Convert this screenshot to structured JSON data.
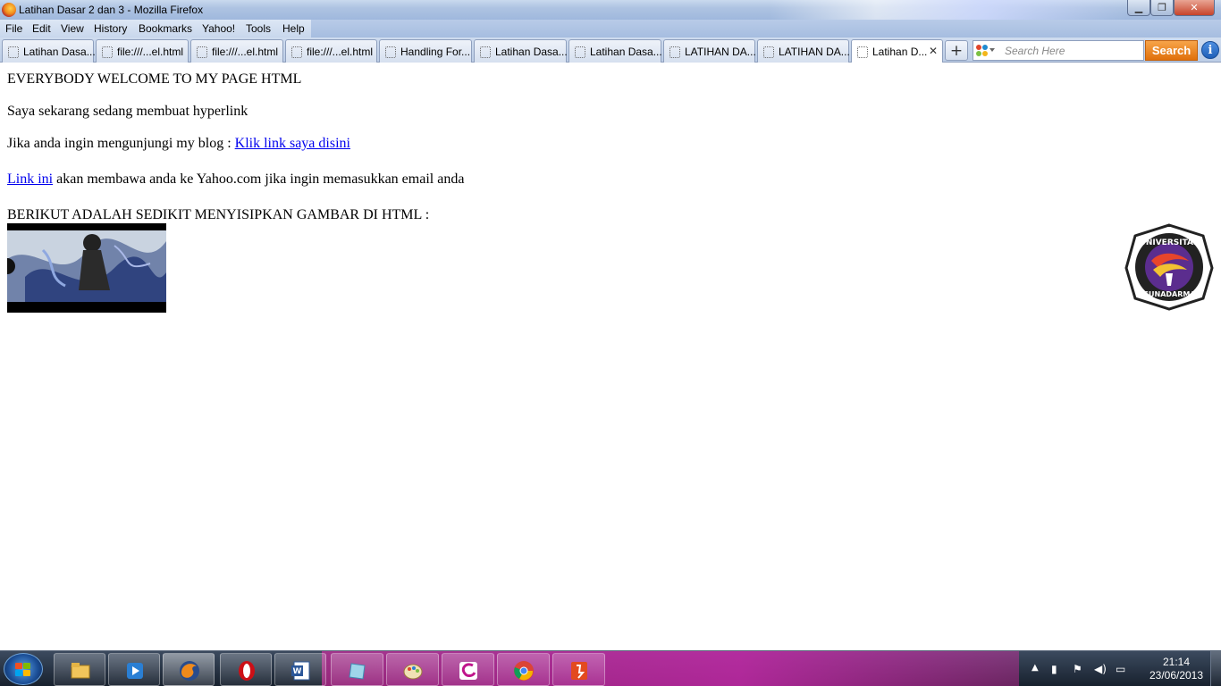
{
  "window": {
    "title": "Latihan Dasar 2 dan 3 - Mozilla Firefox",
    "minimize_glyph": "▁",
    "maximize_glyph": "❐",
    "close_glyph": "✕"
  },
  "menubar": {
    "items": [
      "File",
      "Edit",
      "View",
      "History",
      "Bookmarks",
      "Yahoo!",
      "Tools",
      "Help"
    ]
  },
  "tabs": [
    {
      "label": "Latihan Dasa...",
      "active": false
    },
    {
      "label": "file:///...el.html",
      "active": false
    },
    {
      "label": "file:///...el.html",
      "active": false
    },
    {
      "label": "file:///...el.html",
      "active": false
    },
    {
      "label": "Handling For...",
      "active": false
    },
    {
      "label": "Latihan Dasa...",
      "active": false
    },
    {
      "label": "Latihan Dasa...",
      "active": false
    },
    {
      "label": "LATIHAN DA...",
      "active": false
    },
    {
      "label": "LATIHAN DA...",
      "active": false
    },
    {
      "label": "Latihan D...",
      "active": true,
      "close_glyph": "✕"
    }
  ],
  "toolbar": {
    "new_tab_glyph": "+",
    "search_placeholder": "Search Here",
    "search_button": "Search",
    "info_glyph": "i"
  },
  "page": {
    "heading": "EVERYBODY WELCOME TO MY PAGE HTML",
    "line1": "Saya sekarang sedang membuat hyperlink",
    "line2_prefix": "Jika anda ingin mengunjungi my blog : ",
    "line2_link": "Klik link saya disini",
    "line3_link": "Link ini",
    "line3_suffix": " akan membawa anda ke Yahoo.com jika ingin memasukkan email anda",
    "line4": "BERIKUT ADALAH SEDIKIT MENYISIPKAN GAMBAR DI HTML :",
    "logo_text_top": "UNIVERSITAS",
    "logo_text_bottom": "GUNADARMA"
  },
  "taskbar": {
    "apps": [
      "windows-explorer",
      "media-player",
      "firefox",
      "opera",
      "word",
      "notepad",
      "paint",
      "corel",
      "chrome",
      "acrobat"
    ],
    "clock_time": "21:14",
    "clock_date": "23/06/2013",
    "colors": {
      "accent": "#e228aa"
    }
  }
}
